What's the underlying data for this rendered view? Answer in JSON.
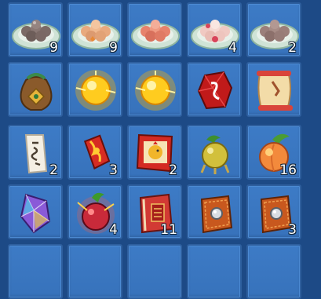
{
  "inventory": {
    "slots": [
      {
        "icon": "dumpling-plate-icon",
        "qty": "9"
      },
      {
        "icon": "dumpling-plate-icon",
        "qty": "9"
      },
      {
        "icon": "dumpling-plate-icon",
        "qty": ""
      },
      {
        "icon": "dumpling-plate-icon",
        "qty": "4"
      },
      {
        "icon": "dumpling-plate-icon",
        "qty": "2"
      },
      {
        "icon": "treasure-pouch-icon",
        "qty": ""
      },
      {
        "icon": "golden-orb-icon",
        "qty": ""
      },
      {
        "icon": "golden-orb-icon",
        "qty": ""
      },
      {
        "icon": "red-gem-icon",
        "qty": ""
      },
      {
        "icon": "scroll-icon",
        "qty": ""
      },
      {
        "icon": "paper-charm-icon",
        "qty": "2"
      },
      {
        "icon": "fire-charm-icon",
        "qty": "3"
      },
      {
        "icon": "rooster-scroll-icon",
        "qty": "2"
      },
      {
        "icon": "golden-fruit-icon",
        "qty": ""
      },
      {
        "icon": "peach-icon",
        "qty": "16"
      },
      {
        "icon": "rainbow-crystal-icon",
        "qty": ""
      },
      {
        "icon": "magic-fruit-icon",
        "qty": "4"
      },
      {
        "icon": "red-book-icon",
        "qty": "11"
      },
      {
        "icon": "orange-pouch-icon",
        "qty": ""
      },
      {
        "icon": "orange-pouch-icon",
        "qty": "3"
      }
    ]
  }
}
